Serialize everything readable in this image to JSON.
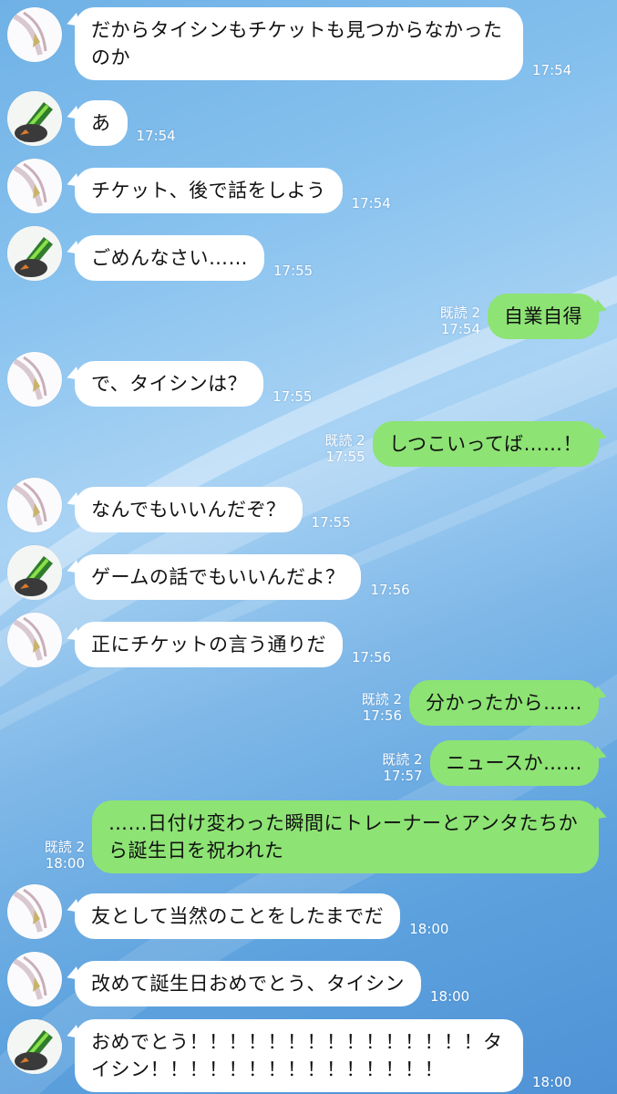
{
  "theme": {
    "bubble_in": "#ffffff",
    "bubble_out": "#8de374",
    "meta_text": "#ffffff"
  },
  "messages": [
    {
      "dir": "left",
      "avatar": "white-hair-avatar",
      "text": "だからタイシンもチケットも見つからなかったのか",
      "time": "17:54"
    },
    {
      "dir": "left",
      "avatar": "green-hair-avatar",
      "text": "あ",
      "time": "17:54"
    },
    {
      "dir": "left",
      "avatar": "white-hair-avatar",
      "text": "チケット、後で話をしよう",
      "time": "17:54"
    },
    {
      "dir": "left",
      "avatar": "green-hair-avatar",
      "text": "ごめんなさい……",
      "time": "17:55"
    },
    {
      "dir": "right",
      "text": "自業自得",
      "read": "既読 2",
      "time": "17:54"
    },
    {
      "dir": "left",
      "avatar": "white-hair-avatar",
      "text": "で、タイシンは？",
      "time": "17:55"
    },
    {
      "dir": "right",
      "text": "しつこいってば……！",
      "read": "既読 2",
      "time": "17:55"
    },
    {
      "dir": "left",
      "avatar": "white-hair-avatar",
      "text": "なんでもいいんだぞ？",
      "time": "17:55"
    },
    {
      "dir": "left",
      "avatar": "green-hair-avatar",
      "text": "ゲームの話でもいいんだよ？",
      "time": "17:56"
    },
    {
      "dir": "left",
      "avatar": "white-hair-avatar",
      "text": "正にチケットの言う通りだ",
      "time": "17:56"
    },
    {
      "dir": "right",
      "text": "分かったから……",
      "read": "既読 2",
      "time": "17:56"
    },
    {
      "dir": "right",
      "text": "ニュースか……",
      "read": "既読 2",
      "time": "17:57"
    },
    {
      "dir": "right",
      "text": "……日付け変わった瞬間にトレーナーとアンタたちから誕生日を祝われた",
      "read": "既読 2",
      "time": "18:00"
    },
    {
      "dir": "left",
      "avatar": "white-hair-avatar",
      "text": "友として当然のことをしたまでだ",
      "time": "18:00"
    },
    {
      "dir": "left",
      "avatar": "white-hair-avatar",
      "text": "改めて誕生日おめでとう、タイシン",
      "time": "18:00"
    },
    {
      "dir": "left",
      "avatar": "green-hair-avatar",
      "text": "おめでとう！！！！！！！！！！！！！！！タイシン！！！！！！！！！！！！！！！",
      "time": "18:00"
    }
  ]
}
